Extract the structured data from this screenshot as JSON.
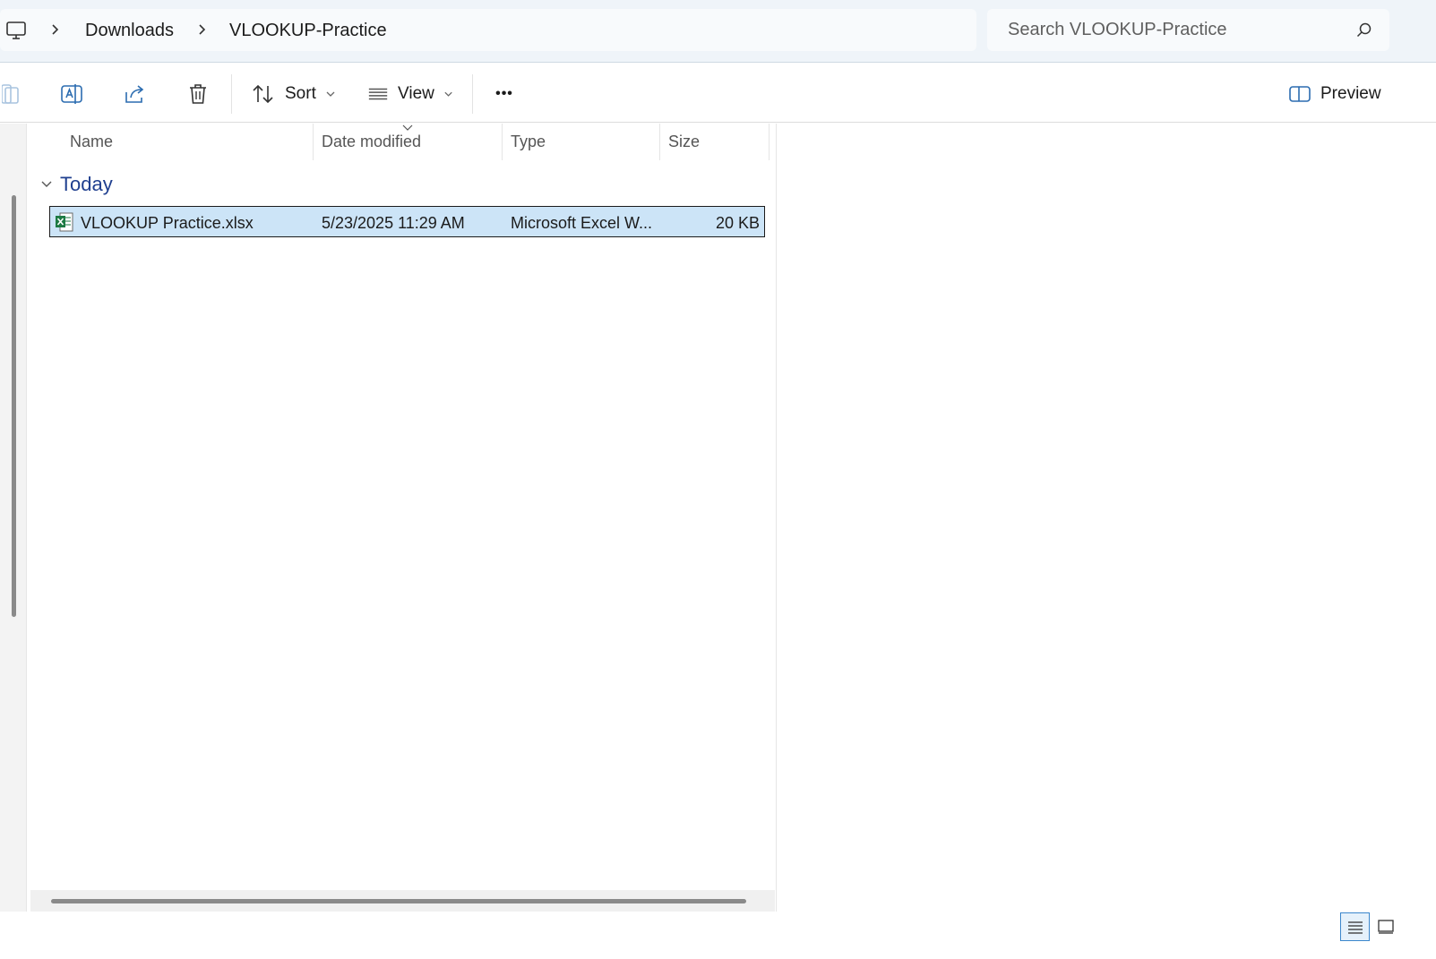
{
  "address": {
    "root_icon": "this-pc-icon",
    "breadcrumbs": [
      "Downloads",
      "VLOOKUP-Practice"
    ]
  },
  "search": {
    "placeholder": "Search VLOOKUP-Practice",
    "icon": "search-icon"
  },
  "toolbar": {
    "sort_label": "Sort",
    "view_label": "View",
    "more_label": "•••",
    "preview_label": "Preview"
  },
  "columns": {
    "name": "Name",
    "date_modified": "Date modified",
    "type": "Type",
    "size": "Size"
  },
  "groups": [
    {
      "label": "Today",
      "files": [
        {
          "name": "VLOOKUP Practice.xlsx",
          "date_modified": "5/23/2025 11:29 AM",
          "type": "Microsoft Excel W...",
          "size": "20 KB",
          "icon": "excel-file-icon",
          "selected": true
        }
      ]
    }
  ],
  "colors": {
    "selection": "#cce4f7",
    "group_header": "#1f3f8f",
    "excel_green": "#1d7a43",
    "address_bg": "#eff4f9"
  }
}
